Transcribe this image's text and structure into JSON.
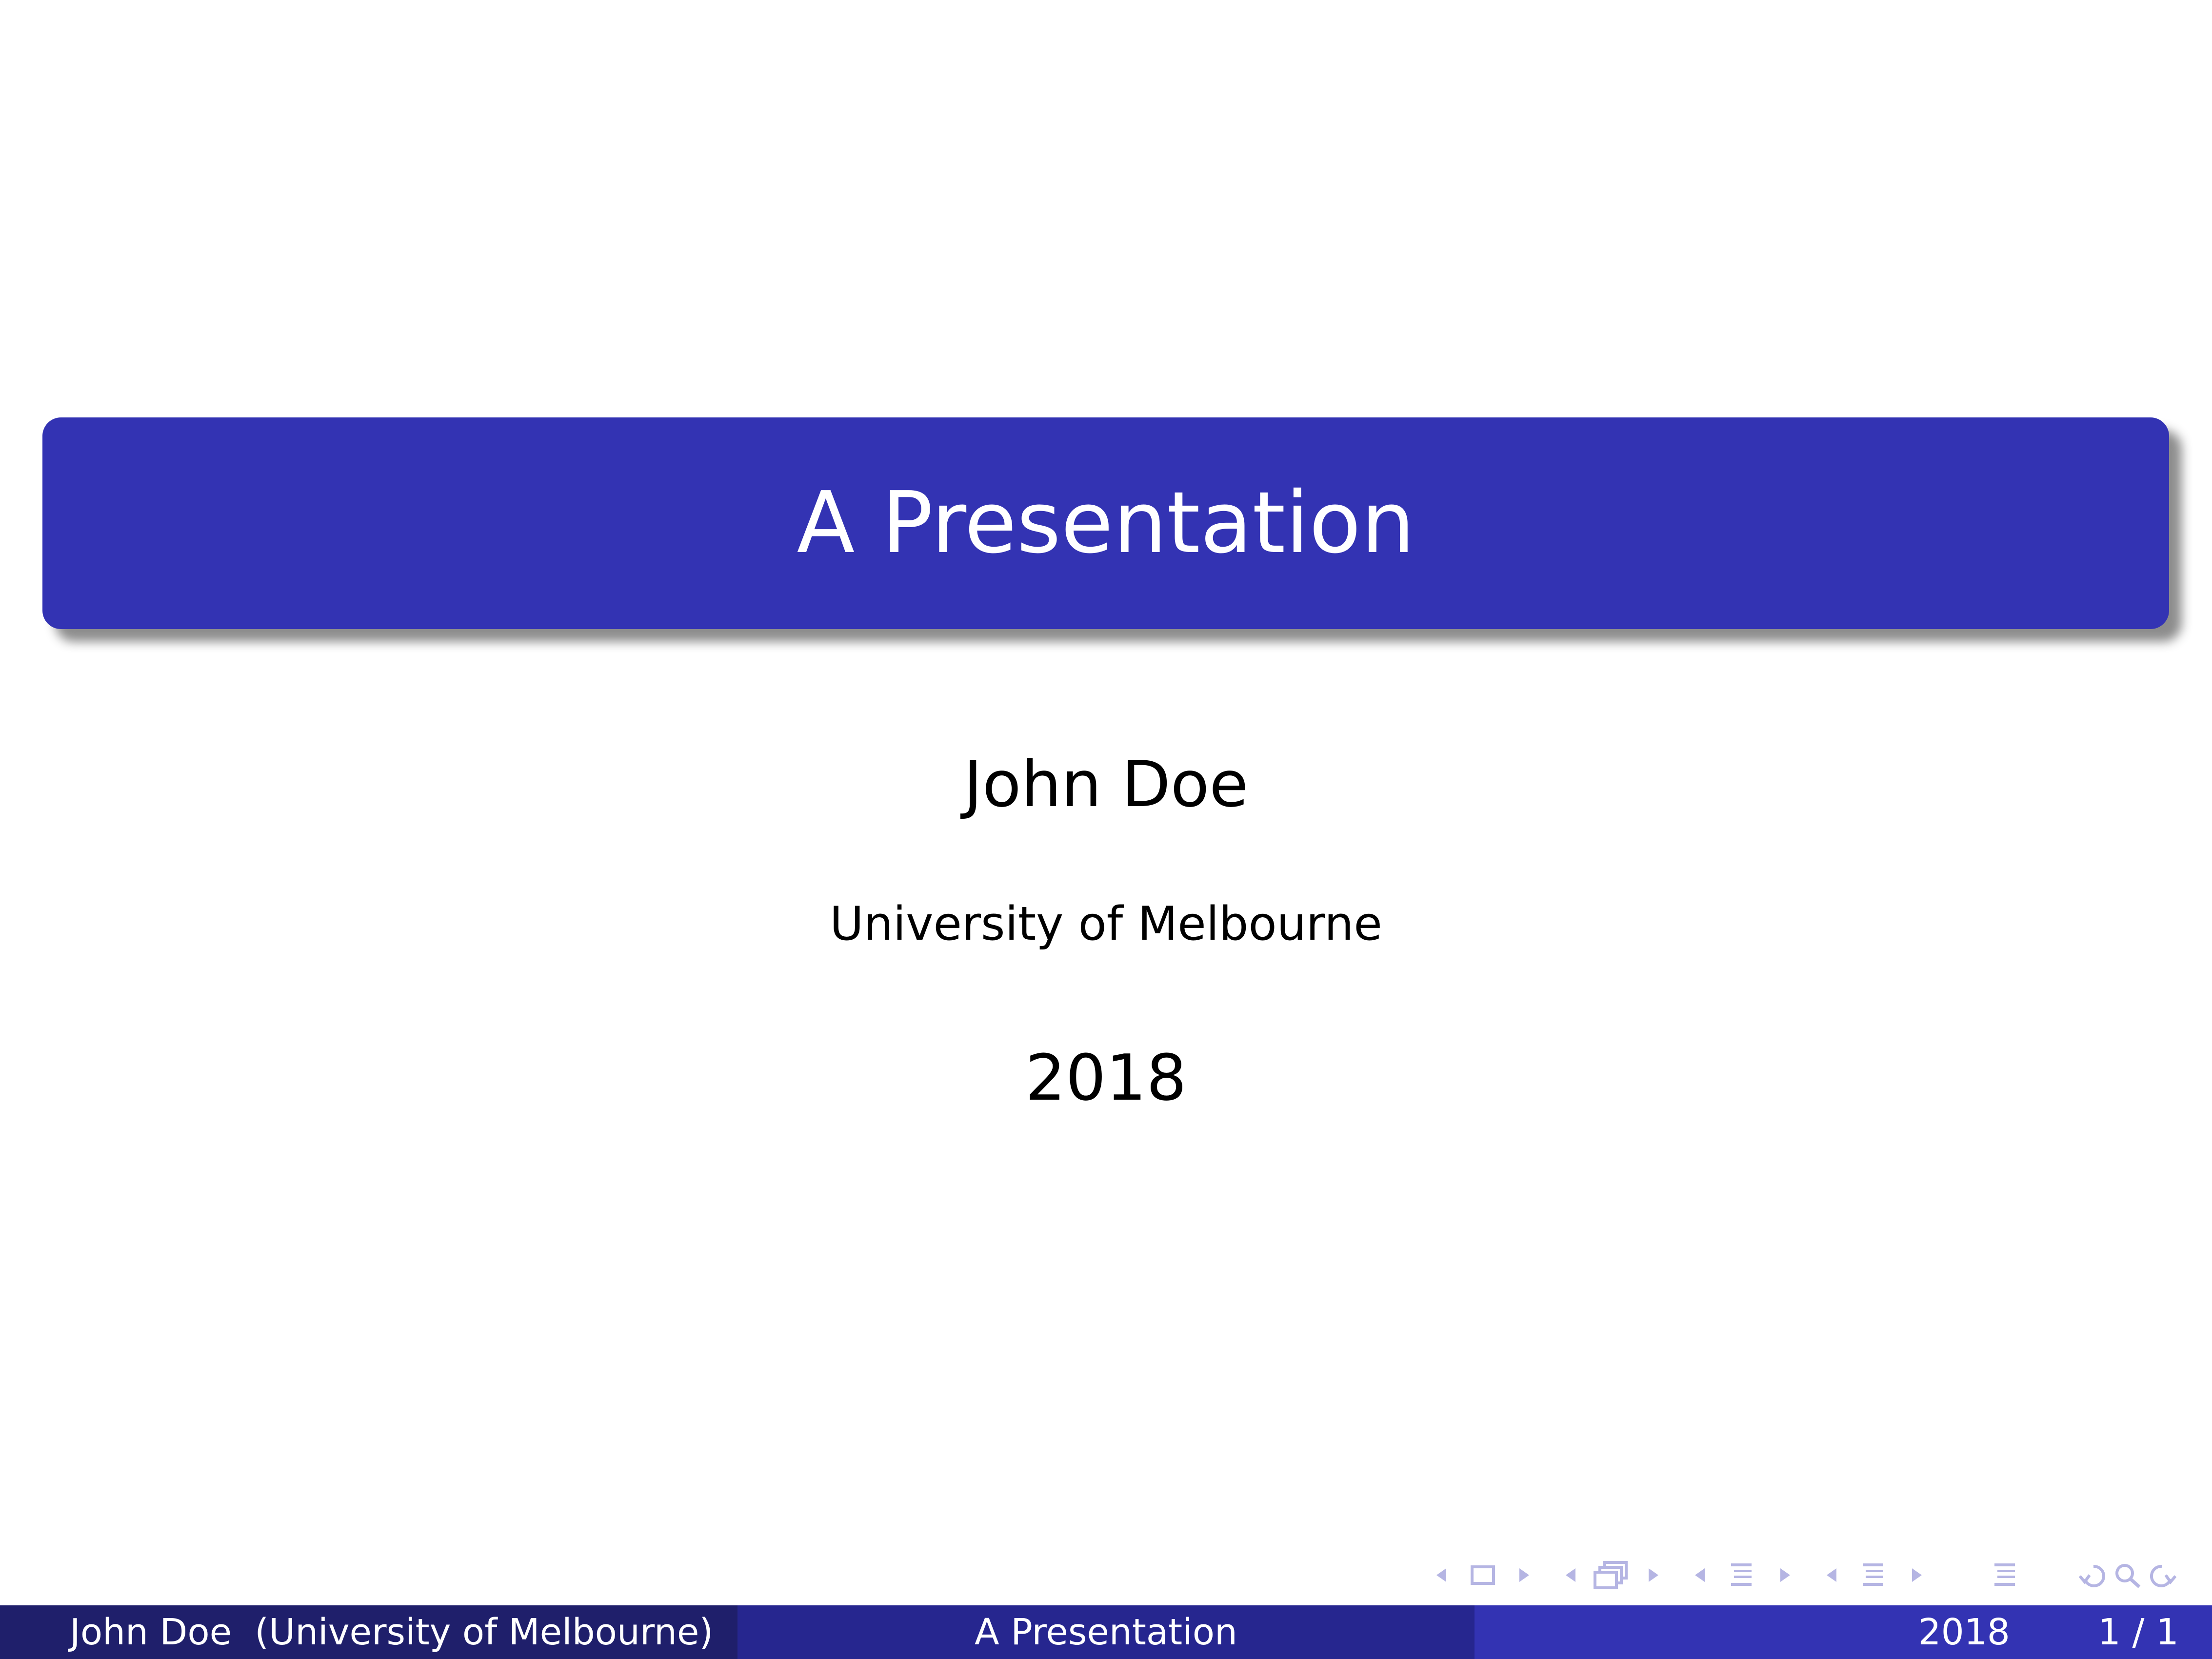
{
  "slide": {
    "title": "A Presentation",
    "author": "John Doe",
    "institute": "University of Melbourne",
    "date": "2018"
  },
  "footer": {
    "left": "John Doe  (University of Melbourne)",
    "center": "A Presentation",
    "date": "2018",
    "page": "1 / 1"
  },
  "colors": {
    "title_bg": "#3333b3",
    "footer_left_bg": "#1f1f6b",
    "footer_center_bg": "#26268f",
    "footer_right_bg": "#3333b3",
    "nav_icons": "#b5b5e3"
  },
  "navigation": {
    "icons": [
      "prev-slide-icon",
      "slide-icon",
      "next-slide-icon",
      "prev-frame-icon",
      "frame-icon",
      "next-frame-icon",
      "prev-subsection-icon",
      "subsection-icon",
      "next-subsection-icon",
      "prev-section-icon",
      "section-icon",
      "next-section-icon",
      "document-icon",
      "back-icon",
      "search-icon",
      "forward-icon"
    ]
  }
}
